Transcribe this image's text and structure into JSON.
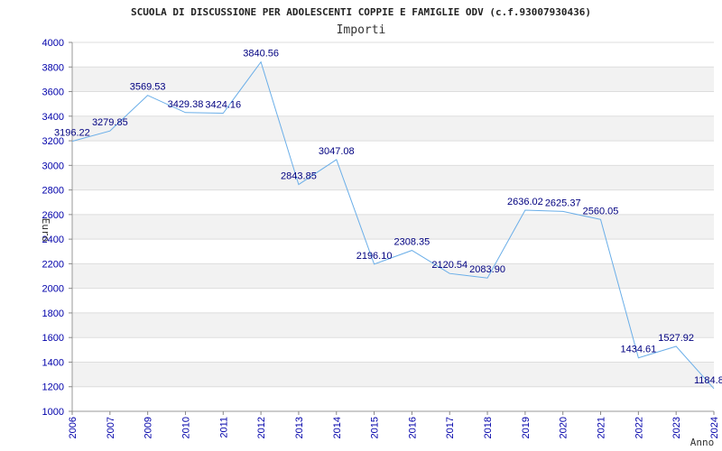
{
  "chart_data": {
    "type": "line",
    "title": "SCUOLA DI DISCUSSIONE PER ADOLESCENTI COPPIE E FAMIGLIE ODV (c.f.93007930436)",
    "subtitle": "Importi",
    "xlabel": "Anno",
    "ylabel": "Euro",
    "x": [
      "2006",
      "2007",
      "2009",
      "2010",
      "2011",
      "2012",
      "2013",
      "2014",
      "2015",
      "2016",
      "2017",
      "2018",
      "2019",
      "2020",
      "2021",
      "2022",
      "2023",
      "2024"
    ],
    "values": [
      3196.22,
      3279.85,
      3569.53,
      3429.38,
      3424.16,
      3840.56,
      2843.85,
      3047.08,
      2196.1,
      2308.35,
      2120.54,
      2083.9,
      2636.02,
      2625.37,
      2560.05,
      1434.61,
      1527.92,
      1184.8
    ],
    "value_labels": [
      "3196.22",
      "3279.85",
      "3569.53",
      "3429.38",
      "3424.16",
      "3840.56",
      "2843.85",
      "3047.08",
      "2196.10",
      "2308.35",
      "2120.54",
      "2083.90",
      "2636.02",
      "2625.37",
      "2560.05",
      "1434.61",
      "1527.92",
      "1184.8"
    ],
    "ylim": [
      1000,
      4000
    ],
    "yticks": [
      "1000",
      "1200",
      "1400",
      "1600",
      "1800",
      "2000",
      "2200",
      "2400",
      "2600",
      "2800",
      "3000",
      "3200",
      "3400",
      "3600",
      "3800",
      "4000"
    ],
    "grid": "horizontal, alternating band shading",
    "colors": {
      "line": "#6aaee8",
      "tick_text": "#0000aa",
      "label_text": "#000080",
      "band_shade": "#f2f2f2",
      "grid": "#dddddd"
    }
  }
}
